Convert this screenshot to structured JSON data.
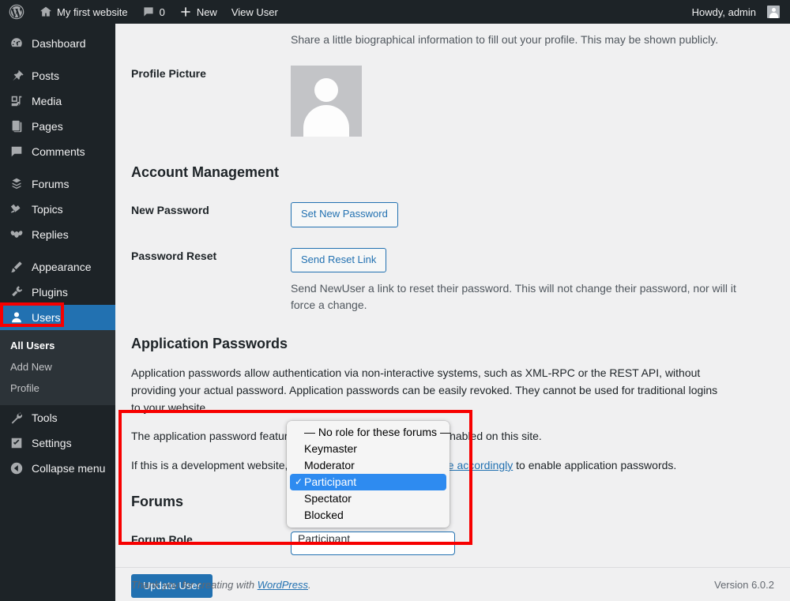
{
  "adminbar": {
    "logo_icon": "wordpress-logo-icon",
    "site_name": "My first website",
    "home_icon": "home-icon",
    "comments_icon": "comment-bubble-icon",
    "comment_count": "0",
    "new_icon": "plus-icon",
    "new_label": "New",
    "view_user_label": "View User",
    "howdy": "Howdy, admin",
    "avatar_icon": "user-avatar-icon"
  },
  "sidebar": {
    "items": [
      {
        "label": "Dashboard",
        "icon": "dashboard-icon",
        "id": "dashboard"
      },
      {
        "label": "Posts",
        "icon": "pin-icon",
        "id": "posts"
      },
      {
        "label": "Media",
        "icon": "media-icon",
        "id": "media"
      },
      {
        "label": "Pages",
        "icon": "pages-icon",
        "id": "pages"
      },
      {
        "label": "Comments",
        "icon": "comment-bubble-icon",
        "id": "comments"
      },
      {
        "label": "Forums",
        "icon": "forums-icon",
        "id": "forums"
      },
      {
        "label": "Topics",
        "icon": "topics-icon",
        "id": "topics"
      },
      {
        "label": "Replies",
        "icon": "replies-icon",
        "id": "replies"
      },
      {
        "label": "Appearance",
        "icon": "brush-icon",
        "id": "appearance"
      },
      {
        "label": "Plugins",
        "icon": "plug-icon",
        "id": "plugins"
      },
      {
        "label": "Users",
        "icon": "user-icon",
        "id": "users"
      },
      {
        "label": "Tools",
        "icon": "wrench-icon",
        "id": "tools"
      },
      {
        "label": "Settings",
        "icon": "settings-icon",
        "id": "settings"
      },
      {
        "label": "Collapse menu",
        "icon": "collapse-arrow-icon",
        "id": "collapse"
      }
    ],
    "current_item": "Users",
    "submenu": [
      {
        "label": "All Users",
        "active": true
      },
      {
        "label": "Add New",
        "active": false
      },
      {
        "label": "Profile",
        "active": false
      }
    ]
  },
  "main": {
    "bio_description": "Share a little biographical information to fill out your profile. This may be shown publicly.",
    "profile_picture_label": "Profile Picture",
    "profile_picture_icon": "default-avatar-icon",
    "account_management_heading": "Account Management",
    "new_password_label": "New Password",
    "set_new_password_button": "Set New Password",
    "password_reset_label": "Password Reset",
    "send_reset_link_button": "Send Reset Link",
    "password_reset_description": "Send NewUser a link to reset their password. This will not change their password, nor will it force a change.",
    "application_passwords_heading": "Application Passwords",
    "app_pw_paragraph_1": "Application passwords allow authentication via non-interactive systems, such as XML-RPC or the REST API, without providing your actual password. Application passwords can be easily revoked. They cannot be used for traditional logins to your website.",
    "app_pw_paragraph_2": "The application password feature requires HTTPS, which is not enabled on this site.",
    "app_pw_paragraph_3_pre": "If this is a development website, you can ",
    "app_pw_paragraph_3_link": "set the environment type accordingly",
    "app_pw_paragraph_3_post": " to enable application passwords.",
    "forums_heading": "Forums",
    "forum_role_label": "Forum Role",
    "forum_role_value": "Participant",
    "update_user_button": "Update User"
  },
  "dropdown": {
    "options": [
      {
        "label": "— No role for these forums —",
        "selected": false
      },
      {
        "label": "Keymaster",
        "selected": false
      },
      {
        "label": "Moderator",
        "selected": false
      },
      {
        "label": "Participant",
        "selected": true
      },
      {
        "label": "Spectator",
        "selected": false
      },
      {
        "label": "Blocked",
        "selected": false
      }
    ],
    "checkmark": "✓"
  },
  "footer": {
    "thanks_pre": "Thank you for creating with ",
    "thanks_link": "WordPress",
    "thanks_post": ".",
    "version": "Version 6.0.2"
  },
  "colors": {
    "admin_bg": "#1d2327",
    "submenu_bg": "#2c3338",
    "accent_blue": "#2271b1",
    "highlight_red": "#f70000",
    "dropdown_selected": "#2e8bf0",
    "content_bg": "#f0f0f1"
  },
  "annotations": {
    "users_highlight": "red-highlight-box-users",
    "forums_highlight": "red-highlight-box-forums"
  }
}
